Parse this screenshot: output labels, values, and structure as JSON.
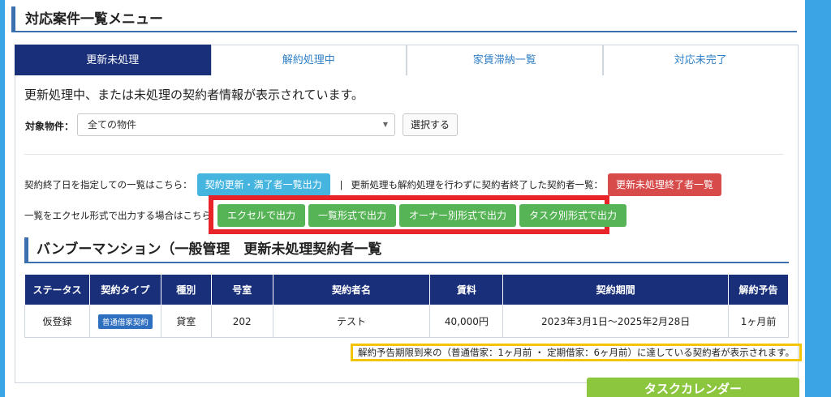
{
  "menu_title": "対応案件一覧メニュー",
  "tabs": [
    {
      "label": "更新未処理",
      "active": true
    },
    {
      "label": "解約処理中",
      "active": false
    },
    {
      "label": "家賃滞納一覧",
      "active": false
    },
    {
      "label": "対応未完了",
      "active": false
    }
  ],
  "description": "更新処理中、または未処理の契約者情報が表示されています。",
  "property": {
    "label": "対象物件：",
    "selected": "全ての物件",
    "select_button": "選択する"
  },
  "contract_end": {
    "text": "契約終了日を指定しての一覧はこちら：",
    "button": "契約更新・満了者一覧出力",
    "separator": "|",
    "text2": "更新処理も解約処理を行わずに契約者終了した契約者一覧：",
    "button2": "更新未処理終了者一覧"
  },
  "export": {
    "label": "一覧をエクセル形式で出力する場合はこちら",
    "buttons": [
      "エクセルで出力",
      "一覧形式で出力",
      "オーナー別形式で出力",
      "タスク別形式で出力"
    ]
  },
  "section_title": "バンブーマンション（一般管理　更新未処理契約者一覧",
  "table": {
    "headers": [
      "ステータス",
      "契約タイプ",
      "種別",
      "号室",
      "契約者名",
      "賃料",
      "契約期間",
      "解約予告"
    ],
    "rows": [
      {
        "status": "仮登録",
        "type": "普通借家契約",
        "kind": "貸室",
        "room": "202",
        "name": "テスト",
        "rent": "40,000円",
        "period": "2023年3月1日～2025年2月28日",
        "notice": "1ヶ月前"
      }
    ]
  },
  "notice": "解約予告期限到来の（普通借家：1ヶ月前 ・ 定期借家：6ヶ月前）に達している契約者が表示されます。",
  "calendar_button": "タスクカレンダー",
  "colors": {
    "navy": "#1a2f7a",
    "accent_blue": "#3aa4e4",
    "green": "#56b356",
    "red_frame": "#e8232a",
    "notice_border": "#f3c400"
  }
}
